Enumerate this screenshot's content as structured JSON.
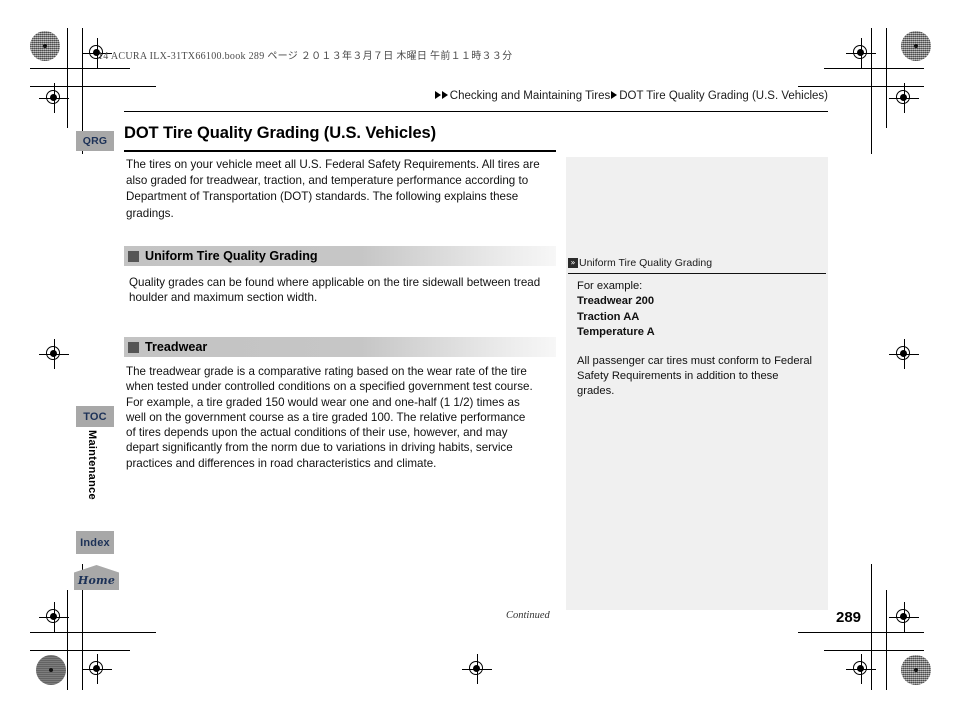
{
  "print_marks": {
    "file_line": "14 ACURA ILX-31TX66100.book   289 ページ   ２０１３年３月７日   木曜日   午前１１時３３分"
  },
  "breadcrumb": {
    "parent": "Checking and Maintaining Tires",
    "current": "DOT Tire Quality Grading (U.S. Vehicles)"
  },
  "tabs": {
    "qrg": "QRG",
    "toc": "TOC",
    "index": "Index",
    "home": "Home",
    "chapter": "Maintenance"
  },
  "main": {
    "title": "DOT Tire Quality Grading (U.S. Vehicles)",
    "intro": "The tires on your vehicle meet all U.S. Federal Safety Requirements. All tires are also graded for treadwear, traction, and temperature performance according to Department of Transportation (DOT) standards. The following explains these gradings.",
    "sections": [
      {
        "heading": "Uniform Tire Quality Grading",
        "body": "Quality grades can be found where applicable on the tire sidewall between tread houlder and maximum section width."
      },
      {
        "heading": "Treadwear",
        "body": "The treadwear grade is a comparative rating based on the wear rate of the tire when tested under controlled conditions on a specified government test course. For example, a tire graded 150 would wear one and one-half (1 1/2) times as well on the government course as a tire graded 100. The relative performance of tires depends upon the actual conditions of their use, however, and may depart significantly from the norm due to variations in driving habits, service practices and differences in road characteristics and climate."
      }
    ]
  },
  "reference_panel": {
    "label": "Uniform Tire Quality Grading",
    "label_icon": "»",
    "intro": "For example:",
    "grades": [
      "Treadwear 200",
      "Traction AA",
      "Temperature A"
    ],
    "note": "All passenger car tires must conform to Federal Safety Requirements in addition to these grades."
  },
  "footer": {
    "continued": "Continued",
    "page_number": "289"
  }
}
